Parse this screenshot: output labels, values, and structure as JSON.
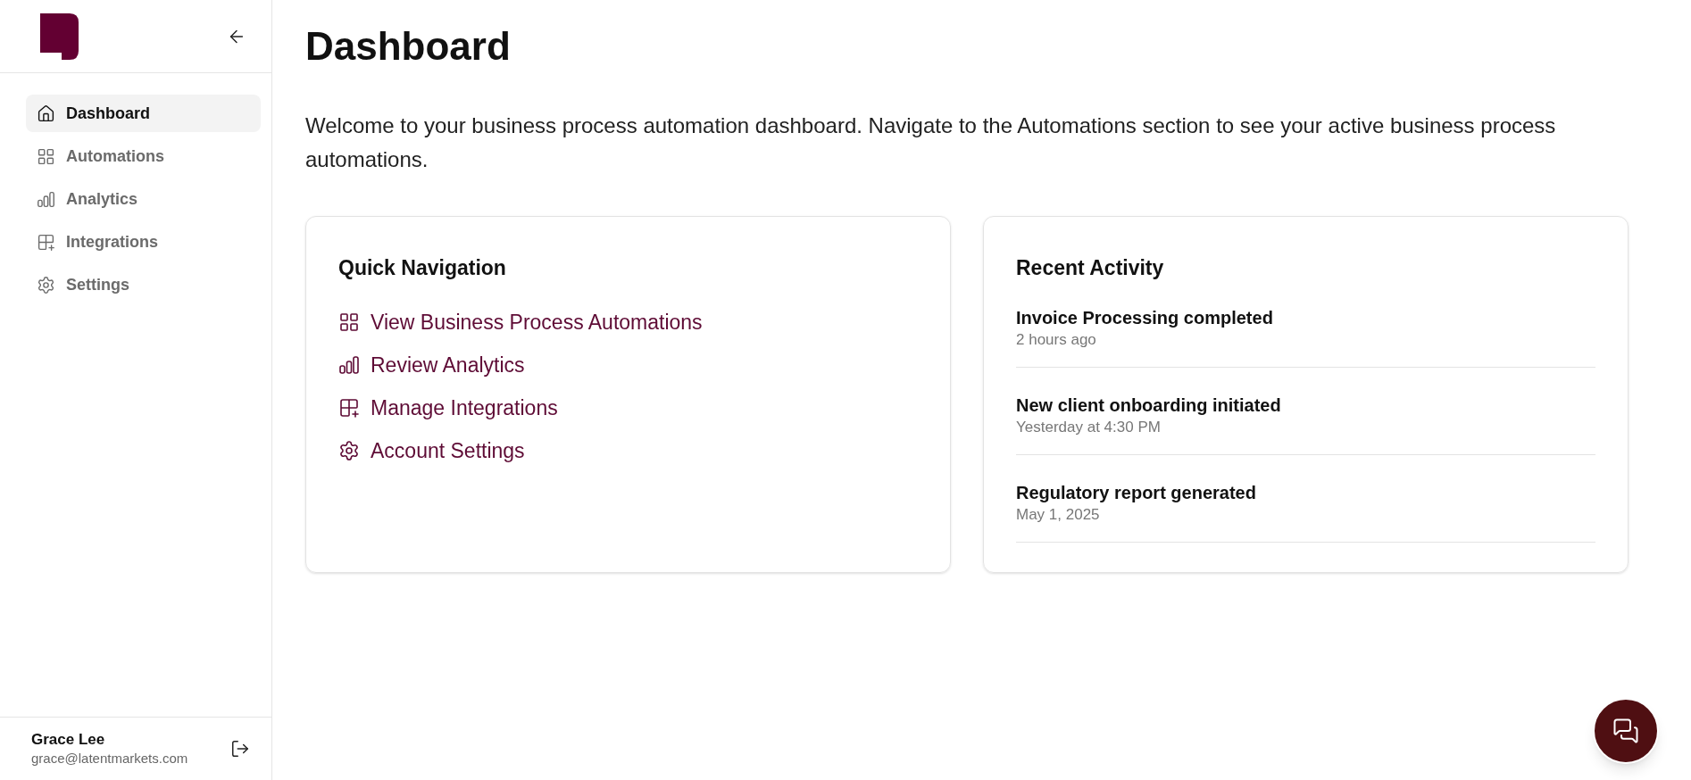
{
  "sidebar": {
    "items": [
      {
        "label": "Dashboard",
        "selected": true
      },
      {
        "label": "Automations",
        "selected": false
      },
      {
        "label": "Analytics",
        "selected": false
      },
      {
        "label": "Integrations",
        "selected": false
      },
      {
        "label": "Settings",
        "selected": false
      }
    ],
    "user": {
      "name": "Grace Lee",
      "email": "grace@latentmarkets.com"
    }
  },
  "page": {
    "title": "Dashboard",
    "intro": "Welcome to your business process automation dashboard. Navigate to the Automations section to see your active business process automations."
  },
  "quick_navigation": {
    "title": "Quick Navigation",
    "links": [
      {
        "label": "View Business Process Automations"
      },
      {
        "label": "Review Analytics"
      },
      {
        "label": "Manage Integrations"
      },
      {
        "label": "Account Settings"
      }
    ]
  },
  "recent_activity": {
    "title": "Recent Activity",
    "items": [
      {
        "title": "Invoice Processing completed",
        "time": "2 hours ago"
      },
      {
        "title": "New client onboarding initiated",
        "time": "Yesterday at 4:30 PM"
      },
      {
        "title": "Regulatory report generated",
        "time": "May 1, 2025"
      }
    ]
  }
}
